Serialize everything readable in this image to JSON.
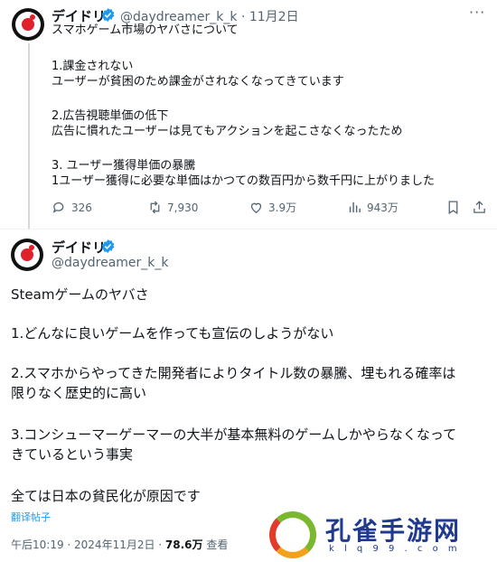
{
  "tweet1": {
    "display_name": "デイドリ",
    "handle_date": "@daydreamer_k_k · 11月2日",
    "lines": [
      "スマホゲーム市場のヤバさについて",
      "",
      "1.課金されない",
      "ユーザーが貧困のため課金がされなくなってきています",
      "",
      "2.広告視聴単価の低下",
      "広告に慣れたユーザーは見てもアクションを起こさなくなったため",
      "",
      "3.  ユーザー獲得単価の暴騰",
      "1ユーザー獲得に必要な単価はかつての数百円から数千円に上がりました"
    ],
    "stats": {
      "replies": "326",
      "retweets": "7,930",
      "likes": "3.9万",
      "views": "943万"
    },
    "more_label": "···"
  },
  "tweet2": {
    "display_name": "デイドリ",
    "handle": "@daydreamer_k_k",
    "lines": [
      "Steamゲームのヤバさ",
      "",
      "1.どんなに良いゲームを作っても宣伝のしようがない",
      "",
      "2.スマホからやってきた開発者によりタイトル数の暴騰、埋もれる確率は",
      "限りなく歴史的に高い",
      "",
      "3.コンシューマーゲーマーの大半が基本無料のゲームしかやらなくなって",
      "きているという事実",
      "",
      "全ては日本の貧民化が原因です"
    ],
    "translate_label": "翻译帖子",
    "meta_time": "午后10:19 · 2024年11月2日 · ",
    "meta_views": "78.6万",
    "meta_views_suffix": " 查看"
  },
  "watermark": {
    "title": "孔雀手游网",
    "url": "k l q 9 9 . c o m"
  },
  "colors": {
    "accent": "#1d9bf0",
    "muted": "#536471",
    "text": "#0f1419",
    "avatar_red": "#e0202a"
  },
  "icons": [
    "more-icon",
    "verified-icon",
    "reply-icon",
    "retweet-icon",
    "like-icon",
    "views-icon",
    "bookmark-icon",
    "share-icon"
  ]
}
